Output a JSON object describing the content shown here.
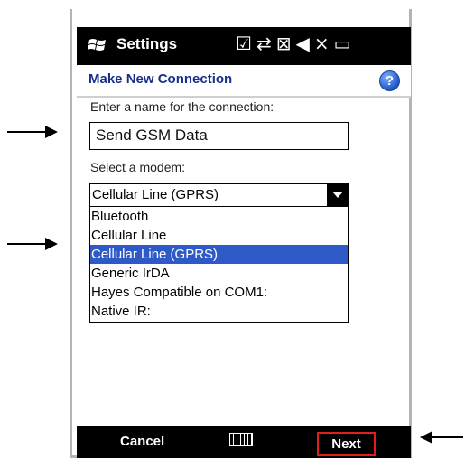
{
  "status_bar": {
    "title": "Settings",
    "icons": [
      "checkbox-icon",
      "data-transfer-icon",
      "connection-off-icon",
      "volume-mute-icon",
      "battery-icon"
    ]
  },
  "header": {
    "title": "Make New Connection",
    "help_label": "?"
  },
  "form": {
    "name_label": "Enter a name for the connection:",
    "name_value": "Send GSM Data",
    "modem_label": "Select a modem:",
    "modem_selected": "Cellular Line (GPRS)",
    "modem_options": [
      "Bluetooth",
      "Cellular Line",
      "Cellular Line (GPRS)",
      "Generic IrDA",
      "Hayes Compatible on COM1:",
      "Native IR:"
    ],
    "highlighted_index": 2
  },
  "bottom_bar": {
    "cancel_label": "Cancel",
    "next_label": "Next"
  },
  "colors": {
    "title_blue": "#1a2f8a",
    "selection_blue": "#2e5ac8",
    "highlight_red": "#e01e1e"
  }
}
